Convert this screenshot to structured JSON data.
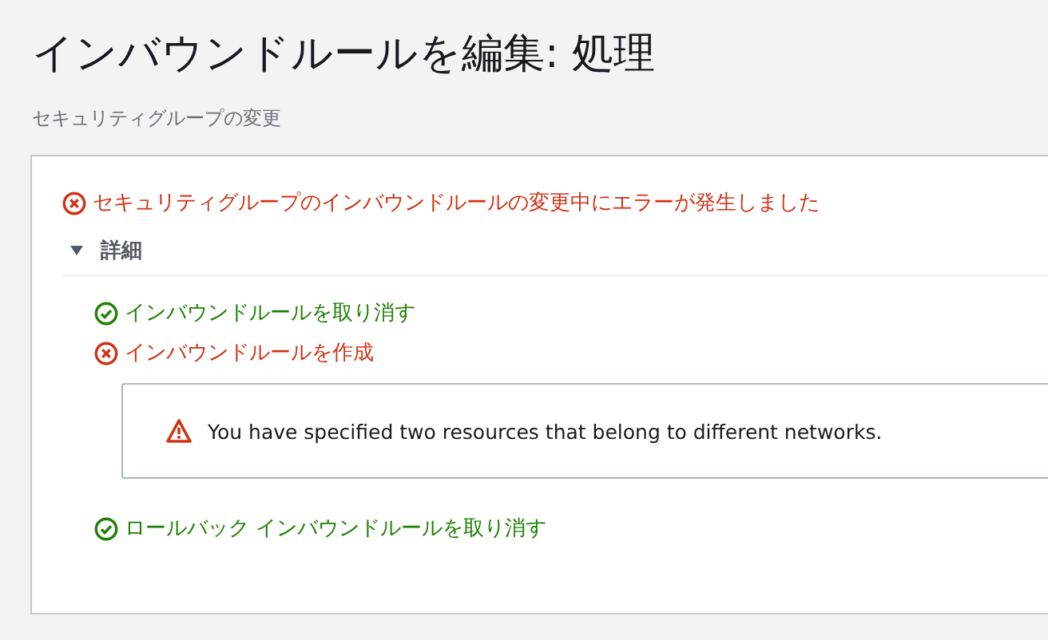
{
  "page": {
    "title": "インバウンドルールを編集: 処理",
    "subtitle": "セキュリティグループの変更"
  },
  "status": {
    "kind": "error",
    "text": "セキュリティグループのインバウンドルールの変更中にエラーが発生しました"
  },
  "details": {
    "label": "詳細",
    "expanded": true,
    "steps": [
      {
        "kind": "success",
        "text": "インバウンドルールを取り消す"
      },
      {
        "kind": "error",
        "text": "インバウンドルールを作成",
        "message": "You have specified two resources that belong to different networks."
      },
      {
        "kind": "success",
        "text": "ロールバック インバウンドルールを取り消す"
      }
    ]
  }
}
